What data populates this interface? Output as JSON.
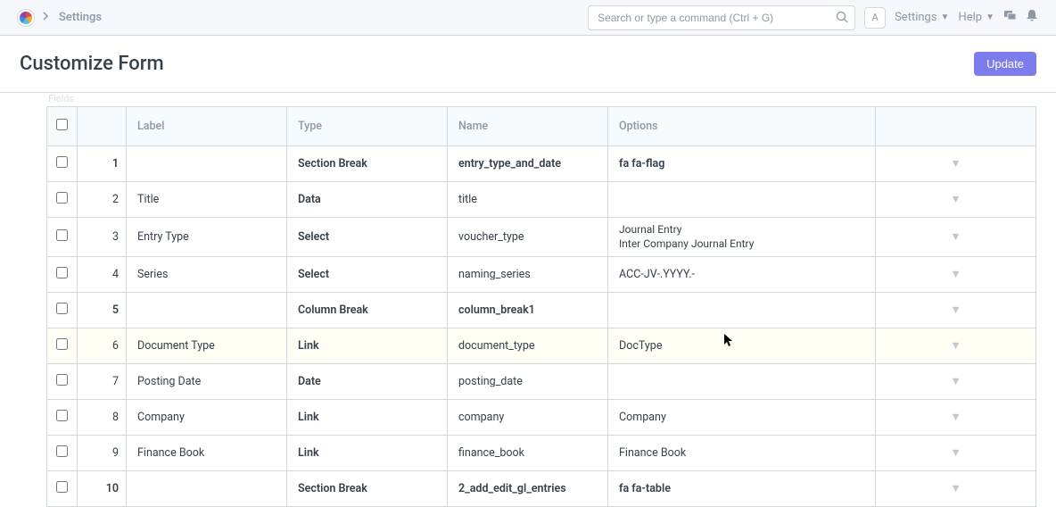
{
  "topbar": {
    "breadcrumb": "Settings",
    "search_placeholder": "Search or type a command (Ctrl + G)",
    "avatar_letter": "A",
    "settings_label": "Settings",
    "help_label": "Help"
  },
  "header": {
    "title": "Customize Form",
    "update_label": "Update"
  },
  "table": {
    "section_label": "Fields",
    "headers": {
      "label": "Label",
      "type": "Type",
      "name": "Name",
      "options": "Options"
    },
    "rows": [
      {
        "idx": "1",
        "label": "",
        "type": "Section Break",
        "name": "entry_type_and_date",
        "options": "fa fa-flag",
        "bold_row": true
      },
      {
        "idx": "2",
        "label": "Title",
        "type": "Data",
        "name": "title",
        "options": ""
      },
      {
        "idx": "3",
        "label": "Entry Type",
        "type": "Select",
        "name": "voucher_type",
        "options": "Journal Entry\nInter Company Journal Entry"
      },
      {
        "idx": "4",
        "label": "Series",
        "type": "Select",
        "name": "naming_series",
        "options": "ACC-JV-.YYYY.-"
      },
      {
        "idx": "5",
        "label": "",
        "type": "Column Break",
        "name": "column_break1",
        "options": "",
        "bold_row": true
      },
      {
        "idx": "6",
        "label": "Document Type",
        "type": "Link",
        "name": "document_type",
        "options": "DocType"
      },
      {
        "idx": "7",
        "label": "Posting Date",
        "type": "Date",
        "name": "posting_date",
        "options": ""
      },
      {
        "idx": "8",
        "label": "Company",
        "type": "Link",
        "name": "company",
        "options": "Company"
      },
      {
        "idx": "9",
        "label": "Finance Book",
        "type": "Link",
        "name": "finance_book",
        "options": "Finance Book"
      },
      {
        "idx": "10",
        "label": "",
        "type": "Section Break",
        "name": "2_add_edit_gl_entries",
        "options": "fa fa-table",
        "bold_row": true
      }
    ]
  }
}
